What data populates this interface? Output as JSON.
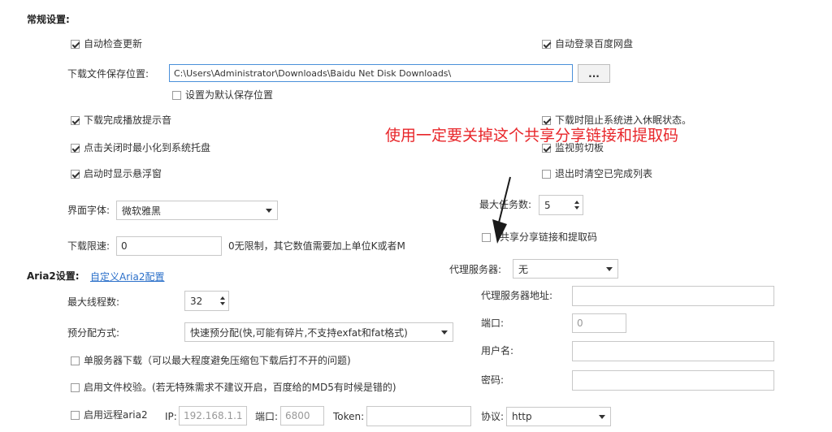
{
  "general": {
    "title": "常规设置:",
    "auto_check_update": "自动检查更新",
    "auto_login": "自动登录百度网盘",
    "download_path_label": "下载文件保存位置:",
    "download_path_value": "C:\\Users\\Administrator\\Downloads\\Baidu Net Disk Downloads\\",
    "browse_label": "...",
    "set_default_path": "设置为默认保存位置",
    "play_sound": "下载完成播放提示音",
    "prevent_sleep": "下载时阻止系统进入休眠状态。",
    "minimize_tray": "点击关闭时最小化到系统托盘",
    "monitor_clipboard": "监视剪切板",
    "show_float": "启动时显示悬浮窗",
    "clear_on_exit": "退出时清空已完成列表",
    "font_label": "界面字体:",
    "font_value": "微软雅黑",
    "max_tasks_label": "最大任务数:",
    "max_tasks_value": "5",
    "speed_limit_label": "下载限速:",
    "speed_limit_value": "0",
    "speed_limit_hint": "0无限制，其它数值需要加上单位K或者M",
    "share_link": "共享分享链接和提取码",
    "annotation": "使用一定要关掉这个共享分享链接和提取码"
  },
  "aria2": {
    "title": "Aria2设置:",
    "custom_link": "自定义Aria2配置",
    "max_threads_label": "最大线程数:",
    "max_threads_value": "32",
    "prealloc_label": "预分配方式:",
    "prealloc_value": "快速预分配(快,可能有碎片,不支持exfat和fat格式)",
    "single_server": "单服务器下载（可以最大程度避免压缩包下载后打不开的问题)",
    "file_check": "启用文件校验。(若无特殊需求不建议开启，百度给的MD5有时候是错的)",
    "remote_aria2": "启用远程aria2",
    "ip_label": "IP:",
    "ip_value": "192.168.1.1",
    "port_label": "端口:",
    "port_value": "6800",
    "token_label": "Token:",
    "token_value": "",
    "protocol_label": "协议:",
    "protocol_value": "http"
  },
  "proxy": {
    "server_label": "代理服务器:",
    "server_value": "无",
    "address_label": "代理服务器地址:",
    "address_value": "",
    "port_label": "端口:",
    "port_value": "0",
    "user_label": "用户名:",
    "user_value": "",
    "password_label": "密码:",
    "password_value": ""
  },
  "colors": {
    "annotation": "#e8262a",
    "link": "#2a6fc9",
    "focus_border": "#4a90d9"
  }
}
